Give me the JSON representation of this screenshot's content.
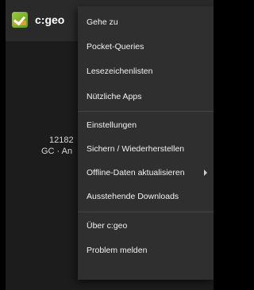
{
  "app": {
    "title": "c:geo",
    "icon": "cgeo-app-icon",
    "background_count": "12182",
    "background_subtitle": "GC · An"
  },
  "menu": {
    "items": [
      {
        "label": "Gehe zu"
      },
      {
        "label": "Pocket-Queries"
      },
      {
        "label": "Lesezeichenlisten"
      },
      {
        "label": "Nützliche Apps"
      },
      {
        "label": "Einstellungen"
      },
      {
        "label": "Sichern / Wiederherstellen"
      },
      {
        "label": "Offline-Daten aktualisieren",
        "submenu": true
      },
      {
        "label": "Ausstehende Downloads"
      },
      {
        "label": "Über c:geo"
      },
      {
        "label": "Problem melden"
      }
    ]
  },
  "colors": {
    "screen_bg": "#1c1c1c",
    "appbar_bg": "#2a2a2a",
    "menu_bg": "#2f2f2f",
    "divider": "#454545",
    "text": "#f2f2f2"
  }
}
